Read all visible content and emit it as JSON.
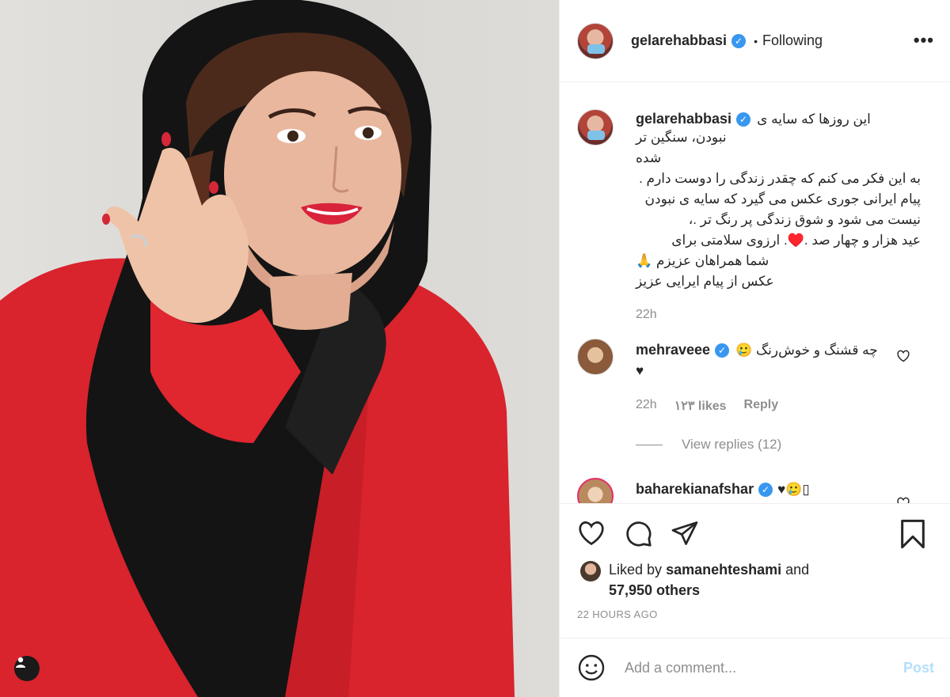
{
  "post": {
    "username": "gelarehabbasi",
    "follow_status": "Following",
    "more_label": "•••",
    "bullet": "•"
  },
  "caption": {
    "username": "gelarehabbasi",
    "lines": [
      "این روزها که سایه ی",
      "نبودن، سنگین تر شده",
      "به این فکر می کنم که چقدر زندگی را دوست دارم .",
      "پیام ایرانی جوری عکس می گیرد که سایه ی نبودن",
      "نیست می شود و شوق زندگی پر رنگ تر .،",
      "عید هزار و چهار صد .♥️. ارزوی سلامتی برای",
      "شما همراهان عزیزم 🙏",
      "عکس از پیام ایرایی عزیز"
    ],
    "time": "22h"
  },
  "comments": [
    {
      "username": "mehraveee",
      "text": "چه قشنگ و خوش‌رنگ 🥲",
      "text2": "♥",
      "time": "22h",
      "likes": "۱۲۳ likes",
      "reply": "Reply",
      "view_replies": "View replies (12)"
    },
    {
      "username": "baharekianafshar",
      "text": "♥🥲▯"
    }
  ],
  "liked_by": {
    "prefix": "Liked by",
    "user": "samanehteshami",
    "and": "and",
    "others": "57,950 others"
  },
  "timestamp": "22 HOURS AGO",
  "add_comment": {
    "placeholder": "Add a comment...",
    "post_label": "Post"
  },
  "colors": {
    "verified": "#3897f0",
    "post_button": "#b2dffc",
    "muted": "#8e8e8e",
    "jacket": "#d92b33"
  }
}
